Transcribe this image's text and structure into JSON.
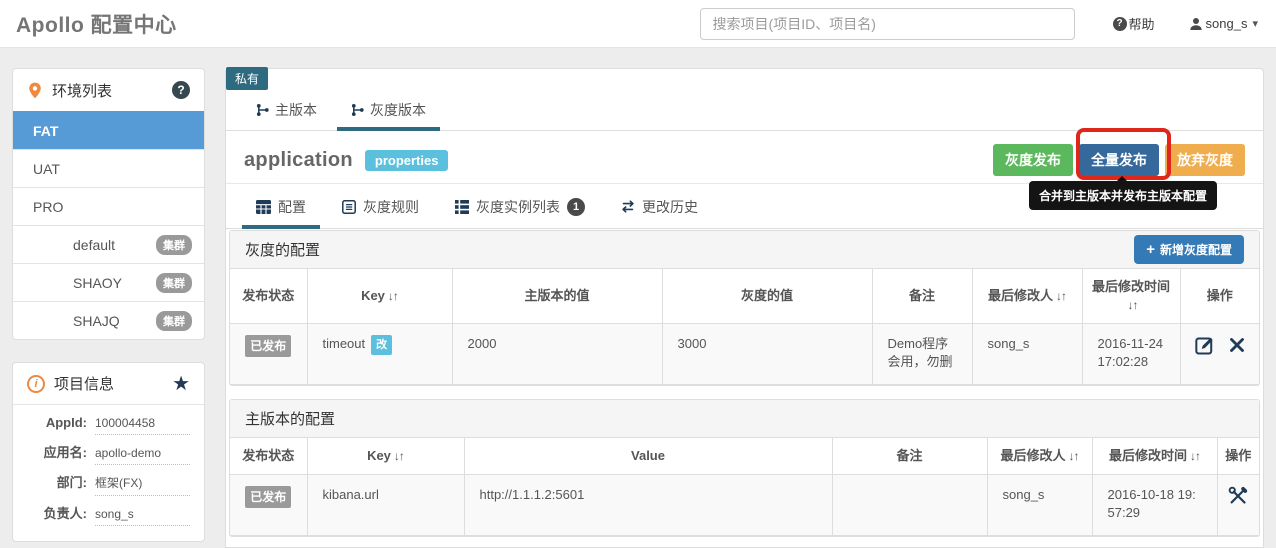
{
  "header": {
    "title": "Apollo 配置中心",
    "search_placeholder": "搜索项目(项目ID、项目名)",
    "help_label": "帮助",
    "user_name": "song_s"
  },
  "icons": {
    "question": "?",
    "info": "i",
    "star": "★",
    "caret_down": "▾",
    "plus": "+",
    "sort": "↓↑"
  },
  "colors": {
    "accent_teal": "#2e6b80",
    "env_active_blue": "#569bd5",
    "button_green": "#5cb85c",
    "button_blue": "#35689b",
    "button_orange": "#f0ad4e",
    "add_button_blue": "#337ab7",
    "info_badge_blue": "#5bc0de",
    "muted_badge_gray": "#9a9a9a",
    "annotation_red": "#e0251b"
  },
  "sidebar": {
    "env_panel": {
      "title": "环境列表",
      "items": [
        {
          "label": "FAT",
          "active": true
        },
        {
          "label": "UAT",
          "active": false
        },
        {
          "label": "PRO",
          "active": false
        },
        {
          "label": "default",
          "badge": "集群"
        },
        {
          "label": "SHAOY",
          "badge": "集群"
        },
        {
          "label": "SHAJQ",
          "badge": "集群"
        }
      ]
    },
    "project_panel": {
      "title": "项目信息",
      "fields": [
        {
          "label": "AppId:",
          "value": "100004458"
        },
        {
          "label": "应用名:",
          "value": "apollo-demo"
        },
        {
          "label": "部门:",
          "value": "框架(FX)"
        },
        {
          "label": "负责人:",
          "value": "song_s"
        }
      ]
    }
  },
  "main": {
    "visibility_tag": "私有",
    "version_tabs": [
      {
        "label": "主版本",
        "active": false
      },
      {
        "label": "灰度版本",
        "active": true
      }
    ],
    "namespace": {
      "name": "application",
      "format": "properties"
    },
    "buttons": {
      "gray_release": "灰度发布",
      "full_release": "全量发布",
      "abandon_gray": "放弃灰度"
    },
    "tooltip": "合并到主版本并发布主版本配置",
    "section_tabs": [
      {
        "label": "配置",
        "active": true
      },
      {
        "label": "灰度规则"
      },
      {
        "label": "灰度实例列表",
        "badge": "1"
      },
      {
        "label": "更改历史"
      }
    ],
    "gray_section": {
      "title": "灰度的配置",
      "add_button_label": "新增灰度配置",
      "table": {
        "headers": [
          "发布状态",
          "Key",
          "主版本的值",
          "灰度的值",
          "备注",
          "最后修改人",
          "最后修改时间",
          "操作"
        ],
        "row": {
          "status": "已发布",
          "key": "timeout",
          "key_badge": "改",
          "master_value": "2000",
          "gray_value": "3000",
          "comment": "Demo程序会用，勿删",
          "modified_by": "song_s",
          "modified_time": "2016-11-24 17:02:28"
        }
      }
    },
    "master_section": {
      "title": "主版本的配置",
      "table": {
        "headers": [
          "发布状态",
          "Key",
          "Value",
          "备注",
          "最后修改人",
          "最后修改时间",
          "操作"
        ],
        "row": {
          "status": "已发布",
          "key": "kibana.url",
          "value": "http://1.1.1.2:5601",
          "comment": "",
          "modified_by": "song_s",
          "modified_time": "2016-10-18 19:57:29"
        }
      }
    }
  }
}
